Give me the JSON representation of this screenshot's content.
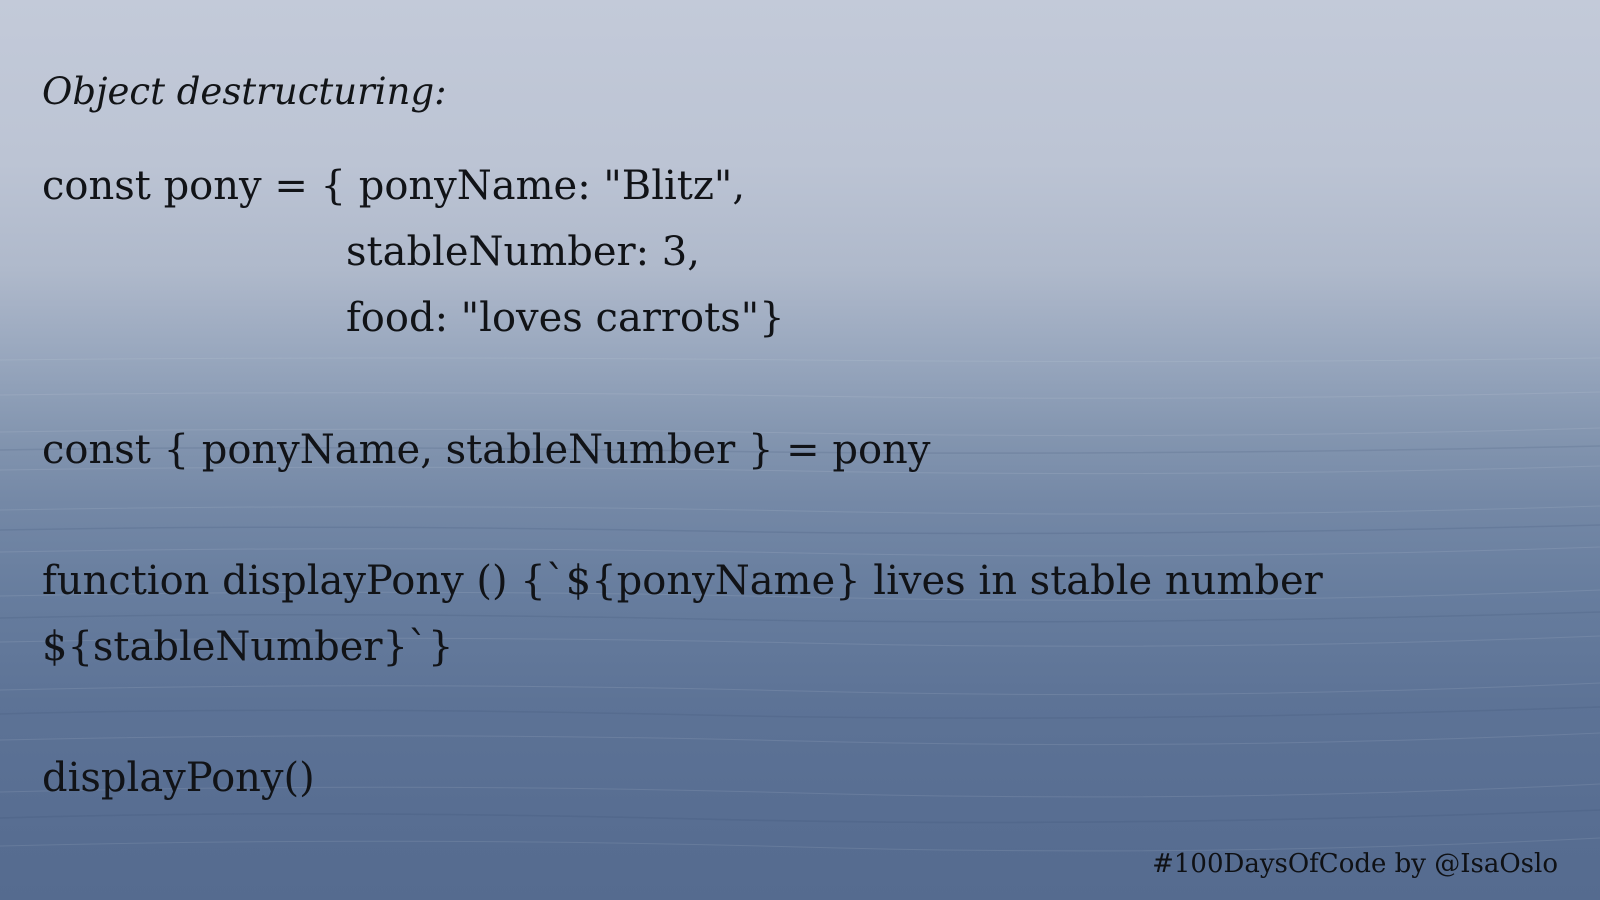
{
  "slide": {
    "heading": "Object destructuring:",
    "code_lines": [
      "const pony = { ponyName: \"Blitz\",",
      "stableNumber: 3,",
      "food: \"loves carrots\"}",
      "const { ponyName, stableNumber } = pony",
      "function displayPony () {`${ponyName} lives in stable number",
      "${stableNumber}`}",
      "displayPony()"
    ],
    "credit": "#100DaysOfCode by @IsaOslo"
  }
}
